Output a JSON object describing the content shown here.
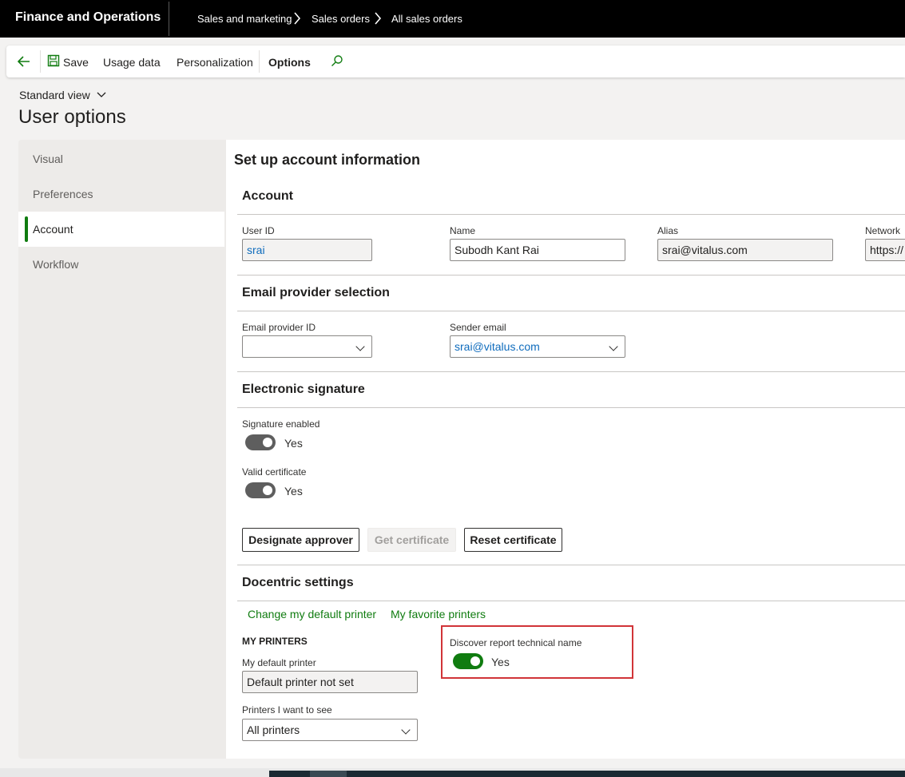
{
  "topbar": {
    "app_title": "Finance and Operations",
    "breadcrumbs": [
      "Sales and marketing",
      "Sales orders",
      "All sales orders"
    ]
  },
  "toolbar": {
    "back_icon": "back-arrow-icon",
    "save_label": "Save",
    "usage_data_label": "Usage data",
    "personalization_label": "Personalization",
    "options_label": "Options",
    "search_icon": "search-icon"
  },
  "view": {
    "selector": "Standard view"
  },
  "page": {
    "title": "User options"
  },
  "nav": {
    "items": [
      {
        "label": "Visual",
        "active": false
      },
      {
        "label": "Preferences",
        "active": false
      },
      {
        "label": "Account",
        "active": true
      },
      {
        "label": "Workflow",
        "active": false
      }
    ]
  },
  "main": {
    "heading": "Set up account information",
    "account": {
      "title": "Account",
      "user_id_label": "User ID",
      "user_id_value": "srai",
      "name_label": "Name",
      "name_value": "Subodh Kant Rai",
      "alias_label": "Alias",
      "alias_value": "srai@vitalus.com",
      "network_label": "Network",
      "network_value": "https://"
    },
    "email": {
      "title": "Email provider selection",
      "provider_label": "Email provider ID",
      "provider_value": "",
      "sender_label": "Sender email",
      "sender_value": "srai@vitalus.com"
    },
    "signature": {
      "title": "Electronic signature",
      "enabled_label": "Signature enabled",
      "enabled_value": "Yes",
      "cert_label": "Valid certificate",
      "cert_value": "Yes",
      "designate_button": "Designate approver",
      "get_cert_button": "Get certificate",
      "reset_cert_button": "Reset certificate"
    },
    "docentric": {
      "title": "Docentric settings",
      "change_printer_link": "Change my default printer",
      "favorite_printers_link": "My favorite printers",
      "my_printers_heading": "MY PRINTERS",
      "default_printer_label": "My default printer",
      "default_printer_value": "Default printer not set",
      "printers_to_see_label": "Printers I want to see",
      "printers_to_see_value": "All printers",
      "discover_label": "Discover report technical name",
      "discover_value": "Yes"
    }
  },
  "colors": {
    "accent": "#107c10",
    "highlight_border": "#d13438",
    "link_blue": "#0f6cbd"
  }
}
